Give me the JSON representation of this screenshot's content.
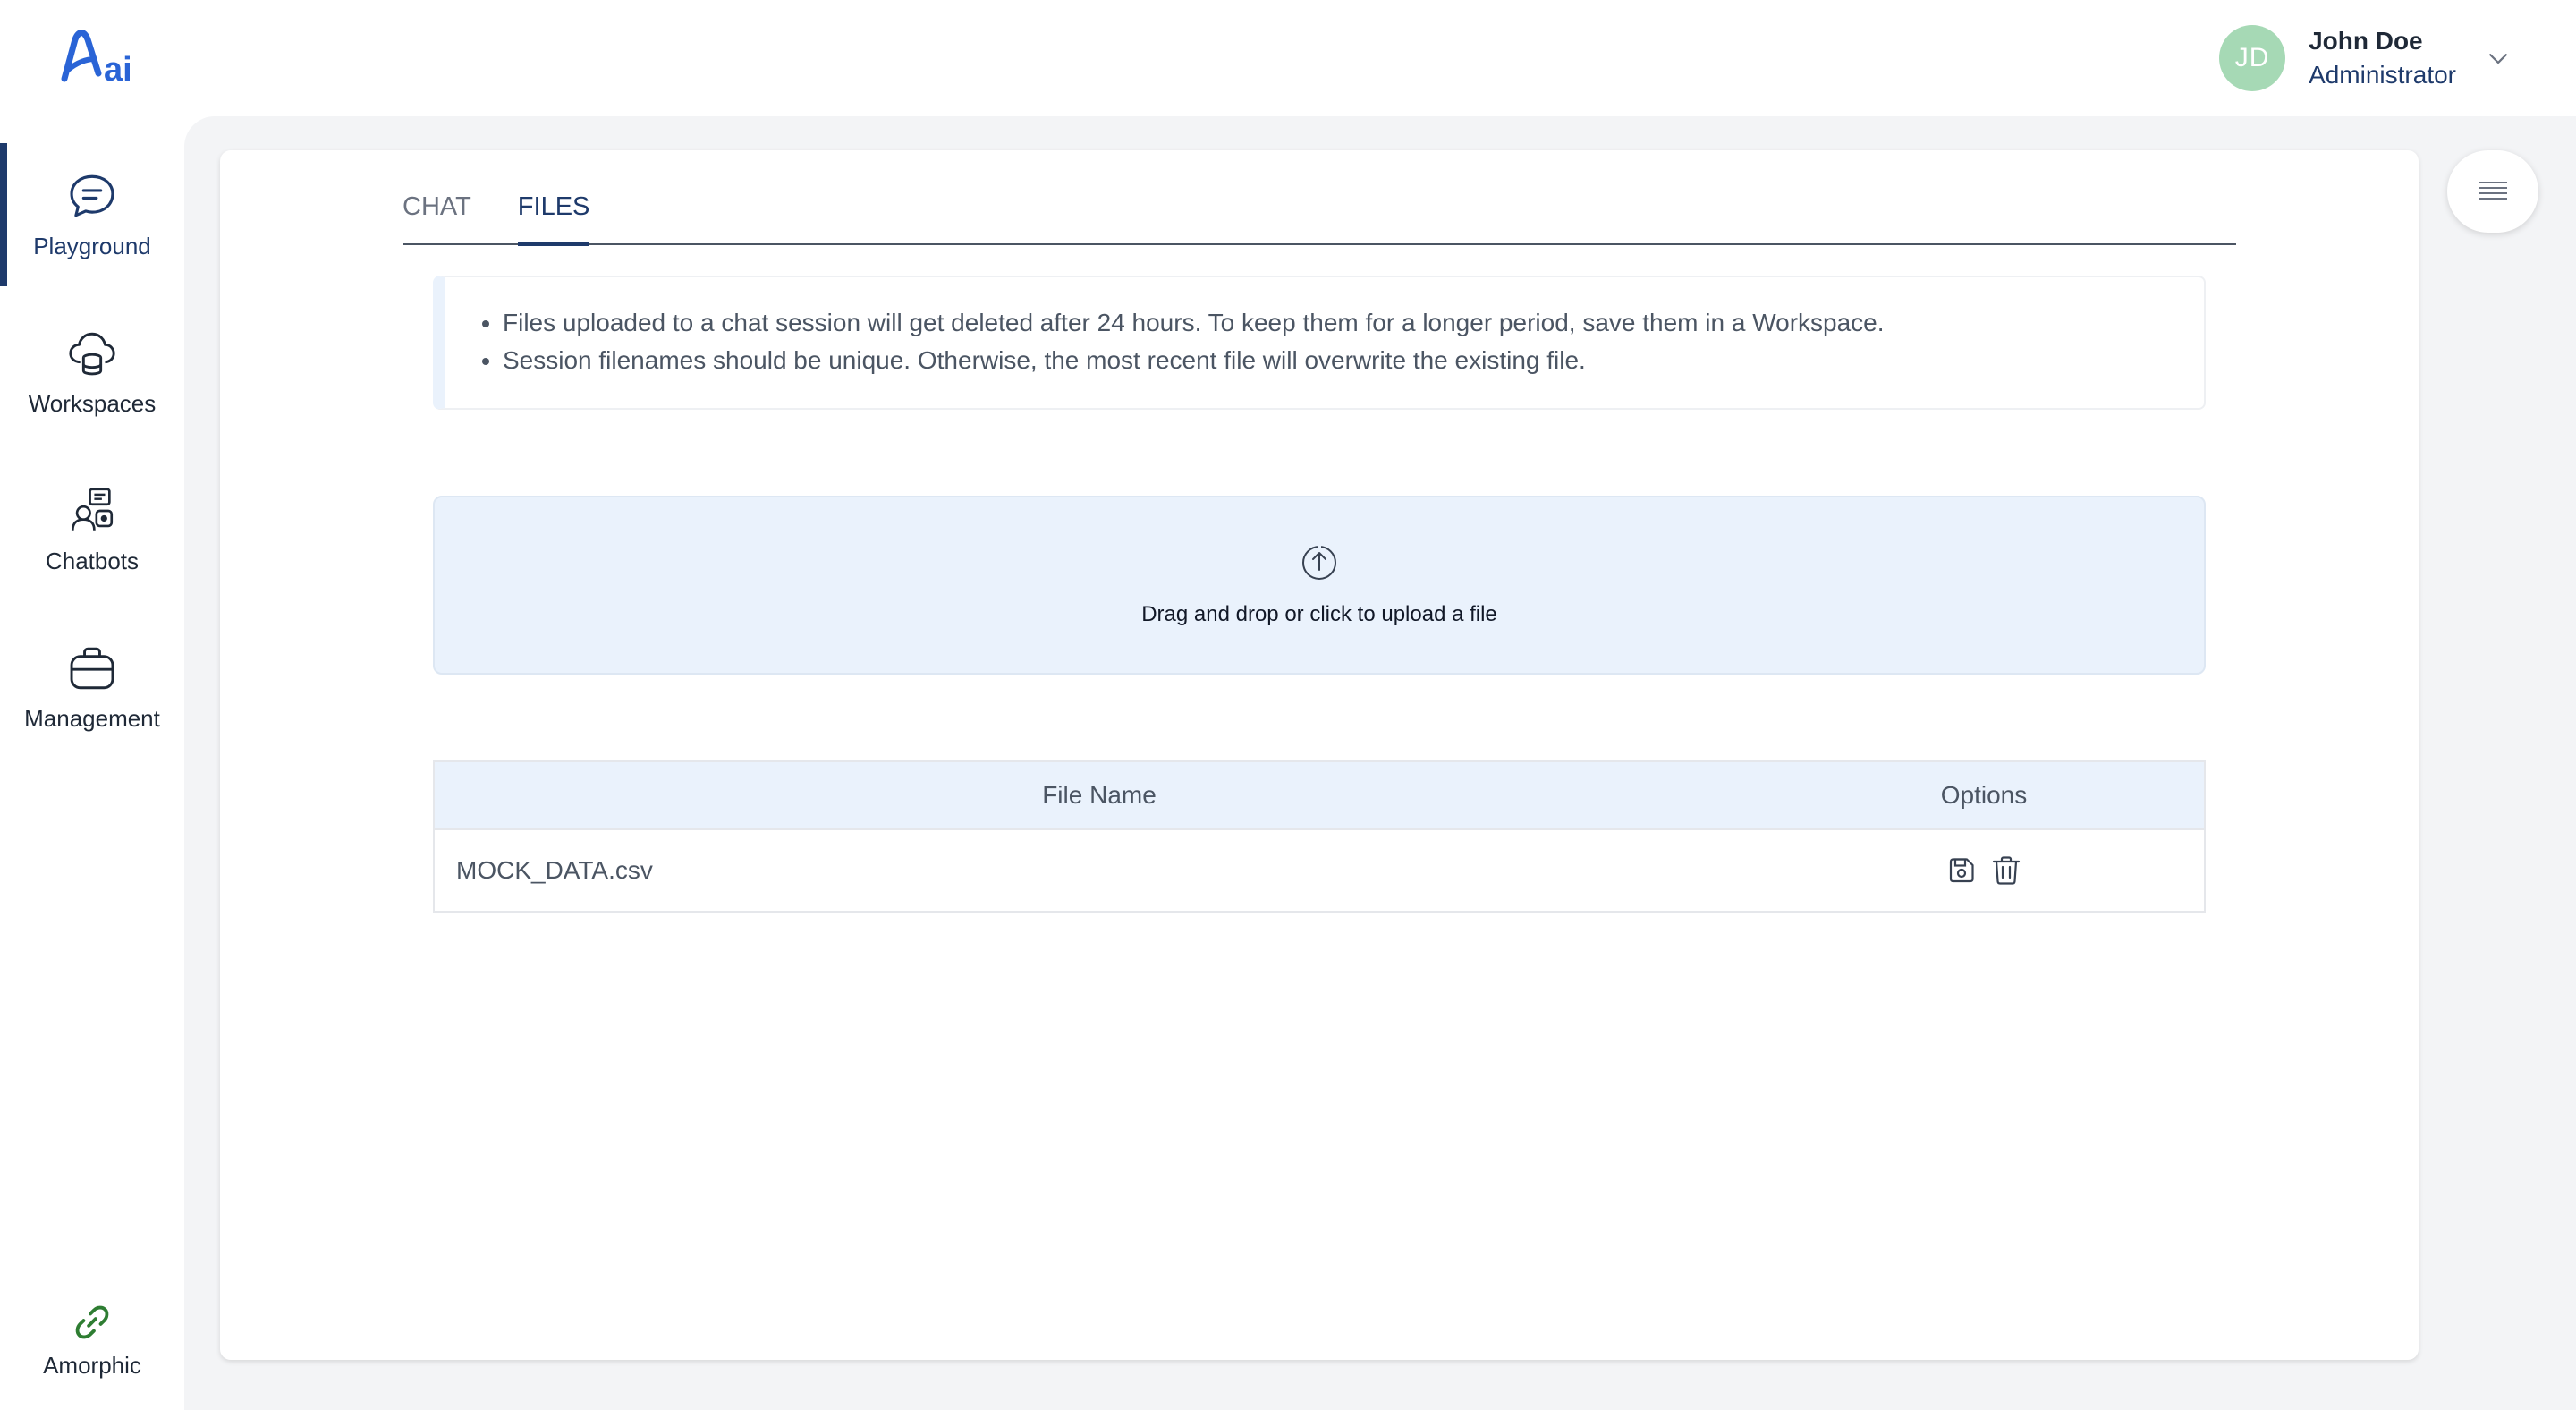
{
  "brand": {
    "logo_text": "ai",
    "accent": "#2a64d6"
  },
  "user": {
    "initials": "JD",
    "name": "John Doe",
    "role": "Administrator",
    "avatar_color": "#a6d9b5"
  },
  "sidebar": {
    "items": [
      {
        "label": "Playground",
        "icon": "chat-bubble-icon",
        "active": true
      },
      {
        "label": "Workspaces",
        "icon": "cloud-database-icon",
        "active": false
      },
      {
        "label": "Chatbots",
        "icon": "chatbot-icon",
        "active": false
      },
      {
        "label": "Management",
        "icon": "briefcase-icon",
        "active": false
      }
    ],
    "footer_link": {
      "label": "Amorphic",
      "icon": "link-icon",
      "color": "#2e7d32"
    }
  },
  "tabs": [
    {
      "label": "CHAT",
      "active": false
    },
    {
      "label": "FILES",
      "active": true
    }
  ],
  "info": {
    "lines": [
      "Files uploaded to a chat session will get deleted after 24 hours. To keep them for a longer period, save them in a Workspace.",
      "Session filenames should be unique. Otherwise, the most recent file will overwrite the existing file."
    ]
  },
  "dropzone": {
    "text": "Drag and drop or click to upload a file",
    "icon": "upload-icon"
  },
  "files_table": {
    "columns": [
      "File Name",
      "Options"
    ],
    "rows": [
      {
        "file_name": "MOCK_DATA.csv",
        "options": [
          "save-icon",
          "trash-icon"
        ]
      }
    ]
  },
  "colors": {
    "primary": "#1e3a6b",
    "panel_bg": "#f3f4f6",
    "highlight_bg": "#eaf2fc"
  }
}
